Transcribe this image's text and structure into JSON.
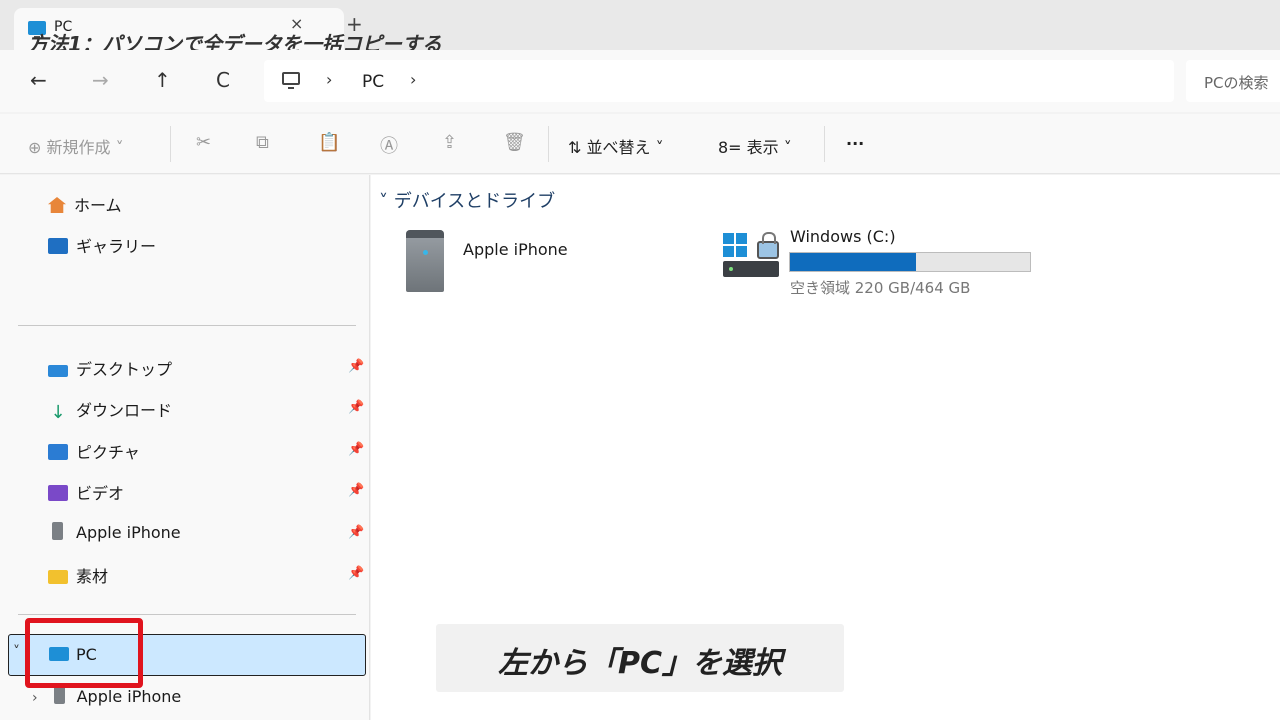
{
  "tab": {
    "title": "PC",
    "close": "×",
    "new": "+"
  },
  "overlay_title": "方法1：パソコンで全データを一括コピーする",
  "nav": {
    "back": "←",
    "forward": "→",
    "up": "↑",
    "refresh": "C"
  },
  "address": {
    "sep1": "›",
    "location": "PC",
    "sep2": "›"
  },
  "search": {
    "placeholder": "PCの検索"
  },
  "toolbar": {
    "new_label": "⊕ 新規作成 ˅",
    "sort_label": "⇅ 並べ替え ˅",
    "view_label": "8= 表示 ˅",
    "more_label": "···"
  },
  "sidebar": {
    "home": "ホーム",
    "gallery": "ギャラリー",
    "pinned": [
      {
        "label": "デスクトップ",
        "icon": "desktop-icon",
        "color": "#2b88d8"
      },
      {
        "label": "ダウンロード",
        "icon": "download-icon",
        "color": "#1a9a6c"
      },
      {
        "label": "ピクチャ",
        "icon": "pictures-icon",
        "color": "#2b7cd3"
      },
      {
        "label": "ビデオ",
        "icon": "videos-icon",
        "color": "#7a49c8"
      },
      {
        "label": "Apple iPhone",
        "icon": "iphone-icon",
        "color": "#7b8085"
      },
      {
        "label": "素材",
        "icon": "folder-icon",
        "color": "#f2c12e"
      }
    ],
    "pc_label": "PC",
    "pc_child": "Apple iPhone",
    "expand": "˅",
    "collapse": "›"
  },
  "main": {
    "group_header": "˅ デバイスとドライブ",
    "device": "Apple iPhone",
    "drive": {
      "name": "Windows (C:)",
      "space": "空き領域 220 GB/464 GB",
      "used_fraction": 0.526
    }
  },
  "caption": "左から「PC」を選択",
  "colors": {
    "accent": "#0f6cbd",
    "highlight": "#e0141e",
    "selected": "#cce8ff"
  }
}
